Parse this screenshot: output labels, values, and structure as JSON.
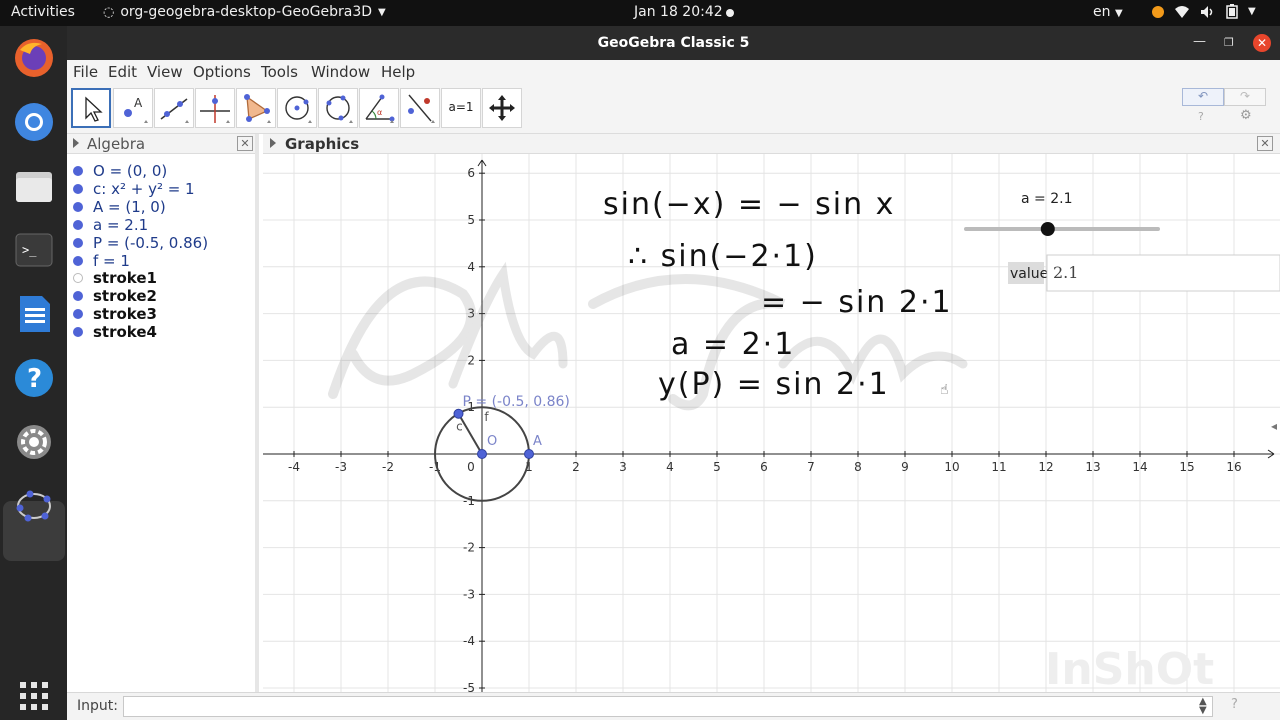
{
  "topbar": {
    "activities": "Activities",
    "app_name": "org-geogebra-desktop-GeoGebra3D",
    "clock": "Jan 18  20:42",
    "lang": "en"
  },
  "window": {
    "title": "GeoGebra Classic 5"
  },
  "menu": [
    "File",
    "Edit",
    "View",
    "Options",
    "Tools",
    "Window",
    "Help"
  ],
  "toolbar": {
    "tools": [
      "move",
      "point",
      "line",
      "perpendicular-line",
      "polygon",
      "circle-center-point",
      "circle-three-points",
      "angle",
      "reflect",
      "slider",
      "move-graphics-view"
    ],
    "slider_tool_label": "a=1",
    "undo_icon": "↶",
    "redo_icon": "↷",
    "help_icon": "?",
    "settings_icon": "⚙"
  },
  "algebra": {
    "title": "Algebra",
    "items": [
      {
        "text": "O = (0, 0)",
        "style": "blue",
        "shown": true
      },
      {
        "text": "c: x² + y² = 1",
        "style": "blue",
        "shown": true
      },
      {
        "text": "A = (1, 0)",
        "style": "blue",
        "shown": true
      },
      {
        "text": "a = 2.1",
        "style": "blue",
        "shown": true
      },
      {
        "text": "P = (-0.5, 0.86)",
        "style": "blue",
        "shown": true
      },
      {
        "text": "f = 1",
        "style": "blue",
        "shown": true
      },
      {
        "text": "stroke1",
        "style": "dark",
        "shown": false
      },
      {
        "text": "stroke2",
        "style": "dark",
        "shown": true
      },
      {
        "text": "stroke3",
        "style": "dark",
        "shown": true
      },
      {
        "text": "stroke4",
        "style": "dark",
        "shown": true
      }
    ]
  },
  "graphics": {
    "title": "Graphics",
    "x_ticks": [
      -4,
      -3,
      -2,
      -1,
      0,
      1,
      2,
      3,
      4,
      5,
      6,
      7,
      8,
      9,
      10,
      11,
      12,
      13,
      14,
      15,
      16
    ],
    "y_ticks": [
      -5,
      -4,
      -3,
      -2,
      -1,
      1,
      2,
      3,
      4,
      5,
      6
    ],
    "origin_label": "0",
    "point_P_label": "P = (-0.5, 0.86)",
    "point_O_label": "O",
    "point_A_label": "A",
    "circle_label": "c",
    "segment_label": "f",
    "slider": {
      "label": "a = 2.1",
      "value": 2.1,
      "min": -5,
      "max": 5
    },
    "value_box": {
      "label": "value",
      "value": "2.1"
    },
    "handwriting": [
      "sin(−x) = − sin x",
      "∴ sin(−2·1)",
      "= − sin 2·1",
      "a = 2·1",
      "y(P) = sin 2·1"
    ],
    "watermark": "InShOt",
    "logo_watermark": "Pk_Tales",
    "colors": {
      "point": "#4f63d6",
      "circle": "#444444",
      "grid": "#e4e4e4",
      "axis": "#222222"
    }
  },
  "input": {
    "label": "Input:",
    "value": "",
    "placeholder": ""
  }
}
